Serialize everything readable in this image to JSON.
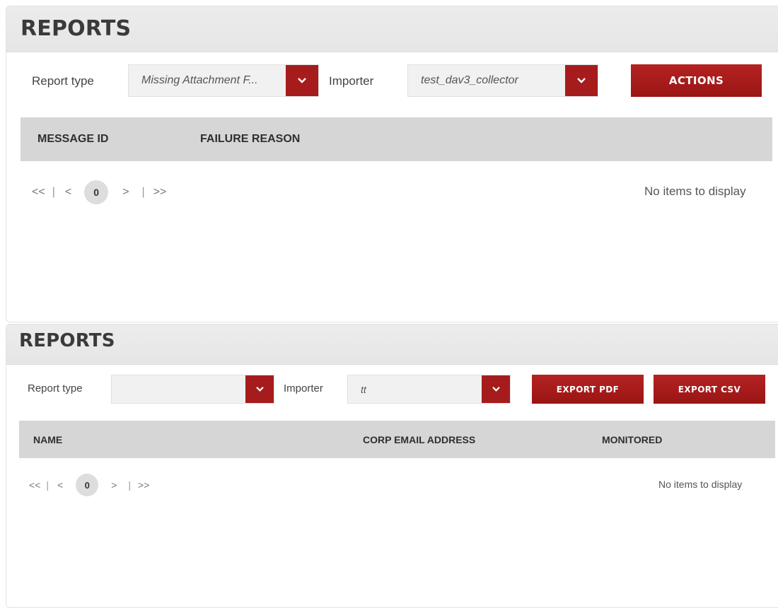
{
  "panel1": {
    "title": "REPORTS",
    "report_type_label": "Report type",
    "report_type_value": "Missing Attachment F...",
    "importer_label": "Importer",
    "importer_value": "test_dav3_collector",
    "actions_label": "ACTIONS",
    "columns": [
      "MESSAGE ID",
      "FAILURE REASON"
    ],
    "pager": {
      "first": "<<",
      "prev": "<",
      "page": "0",
      "next": ">",
      "last": ">>"
    },
    "empty_text": "No items to display"
  },
  "panel2": {
    "title": "REPORTS",
    "report_type_label": "Report type",
    "report_type_value": "",
    "importer_label": "Importer",
    "importer_value": "tt",
    "export_pdf_label": "EXPORT PDF",
    "export_csv_label": "EXPORT CSV",
    "columns": [
      "NAME",
      "CORP EMAIL ADDRESS",
      "MONITORED"
    ],
    "pager": {
      "first": "<<",
      "prev": "<",
      "page": "0",
      "next": ">",
      "last": ">>"
    },
    "empty_text": "No items to display"
  },
  "colors": {
    "accent": "#a61c1c",
    "header_bg": "#e8e8e8",
    "table_header_bg": "#d6d6d6"
  },
  "icons": {
    "caret": "chevron-down-icon"
  }
}
